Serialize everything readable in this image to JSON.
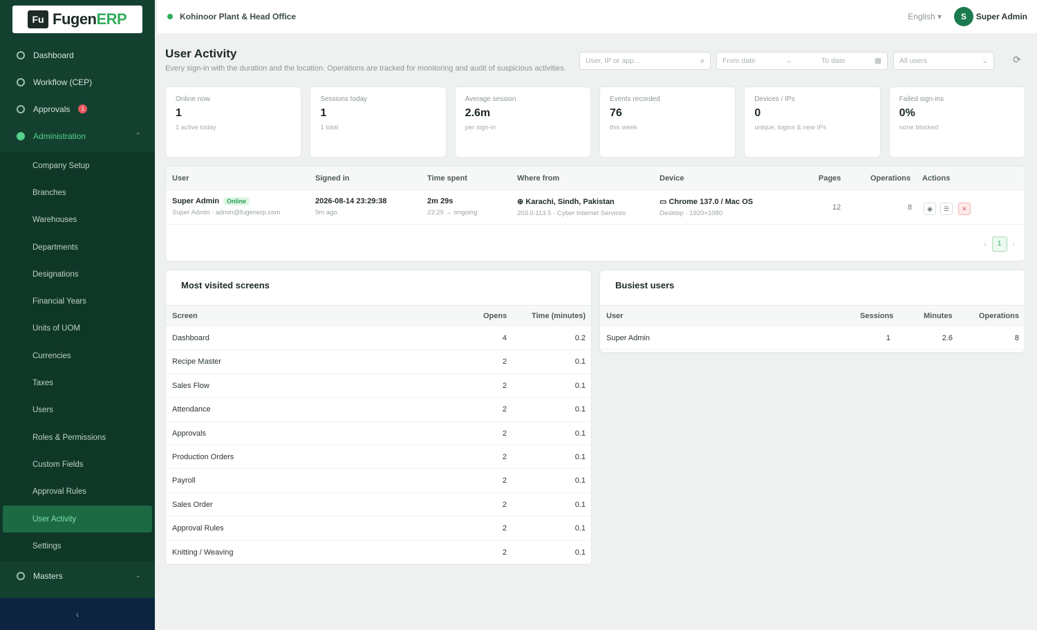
{
  "app": {
    "logo_mark": "Fu",
    "logo_text_main": "Fugen",
    "logo_text_accent": "ERP"
  },
  "sidebar": {
    "top_items": [
      {
        "label": "Dashboard",
        "icon": "dashboard-icon"
      },
      {
        "label": "Workflow (CEP)",
        "icon": "workflow-icon"
      },
      {
        "label": "Approvals",
        "icon": "approvals-icon",
        "badge": "1"
      },
      {
        "label": "Administration",
        "icon": "admin-icon",
        "expanded": true
      }
    ],
    "sub_items": [
      "Company Setup",
      "Branches",
      "Warehouses",
      "Departments",
      "Designations",
      "Financial Years",
      "Units of UOM",
      "Currencies",
      "Taxes",
      "Users",
      "Roles & Permissions",
      "Custom Fields",
      "Approval Rules",
      "User Activity",
      "Settings"
    ],
    "active_sub_index": 13,
    "bottom_items": [
      {
        "label": "Masters",
        "icon": "masters-icon"
      }
    ],
    "collapse_label": "‹"
  },
  "topbar": {
    "company": "Kohinoor Plant & Head Office",
    "language": "English ▾",
    "avatar_initial": "S",
    "user_name": "Super Admin"
  },
  "page": {
    "title": "User Activity",
    "subtitle": "Every sign-in with the duration and the location. Operations are tracked for monitoring and audit of suspicious activities."
  },
  "filters": {
    "search_placeholder": "User, IP or app…",
    "from_placeholder": "From date",
    "to_placeholder": "To date",
    "users_placeholder": "All users"
  },
  "stats": [
    {
      "label": "Online now",
      "value": "1",
      "sub": "1 active today"
    },
    {
      "label": "Sessions today",
      "value": "1",
      "sub": "1 total"
    },
    {
      "label": "Average session",
      "value": "2.6m",
      "sub": "per sign-in"
    },
    {
      "label": "Events recorded",
      "value": "76",
      "sub": "this week"
    },
    {
      "label": "Devices / IPs",
      "value": "0",
      "sub": "unique, logins & new IPs"
    },
    {
      "label": "Failed sign-ins",
      "value": "0%",
      "sub": "none blocked"
    }
  ],
  "sessions": {
    "headers": [
      "User",
      "Signed in",
      "Time spent",
      "Where from",
      "Device",
      "Pages",
      "Operations",
      "Actions"
    ],
    "rows": [
      {
        "user": "Super Admin",
        "status": "Online",
        "user_sub": "Super Admin · admin@fugenerp.com",
        "signed_in": "2026-08-14 23:29:38",
        "signed_in_sub": "9m ago",
        "time_spent": "2m 29s",
        "time_spent_sub": "23:29 → ongoing",
        "where": "Karachi, Sindh, Pakistan",
        "where_sub": "203.0.113.5 · Cyber Internet Services",
        "device": "Chrome 137.0 / Mac OS",
        "device_sub": "Desktop · 1920×1080",
        "pages": "12",
        "operations": "8"
      }
    ],
    "page_current": "1"
  },
  "top_screens": {
    "title": "Most visited screens",
    "headers": [
      "Screen",
      "Opens",
      "Time (minutes)"
    ],
    "rows": [
      [
        "Dashboard",
        "4",
        "0.2"
      ],
      [
        "Recipe Master",
        "2",
        "0.1"
      ],
      [
        "Sales Flow",
        "2",
        "0.1"
      ],
      [
        "Attendance",
        "2",
        "0.1"
      ],
      [
        "Approvals",
        "2",
        "0.1"
      ],
      [
        "Production Orders",
        "2",
        "0.1"
      ],
      [
        "Payroll",
        "2",
        "0.1"
      ],
      [
        "Sales Order",
        "2",
        "0.1"
      ],
      [
        "Approval Rules",
        "2",
        "0.1"
      ],
      [
        "Knitting / Weaving",
        "2",
        "0.1"
      ]
    ]
  },
  "busiest_users": {
    "title": "Busiest users",
    "headers": [
      "User",
      "Sessions",
      "Minutes",
      "Operations"
    ],
    "rows": [
      [
        "Super Admin",
        "1",
        "2.6",
        "8"
      ]
    ]
  }
}
